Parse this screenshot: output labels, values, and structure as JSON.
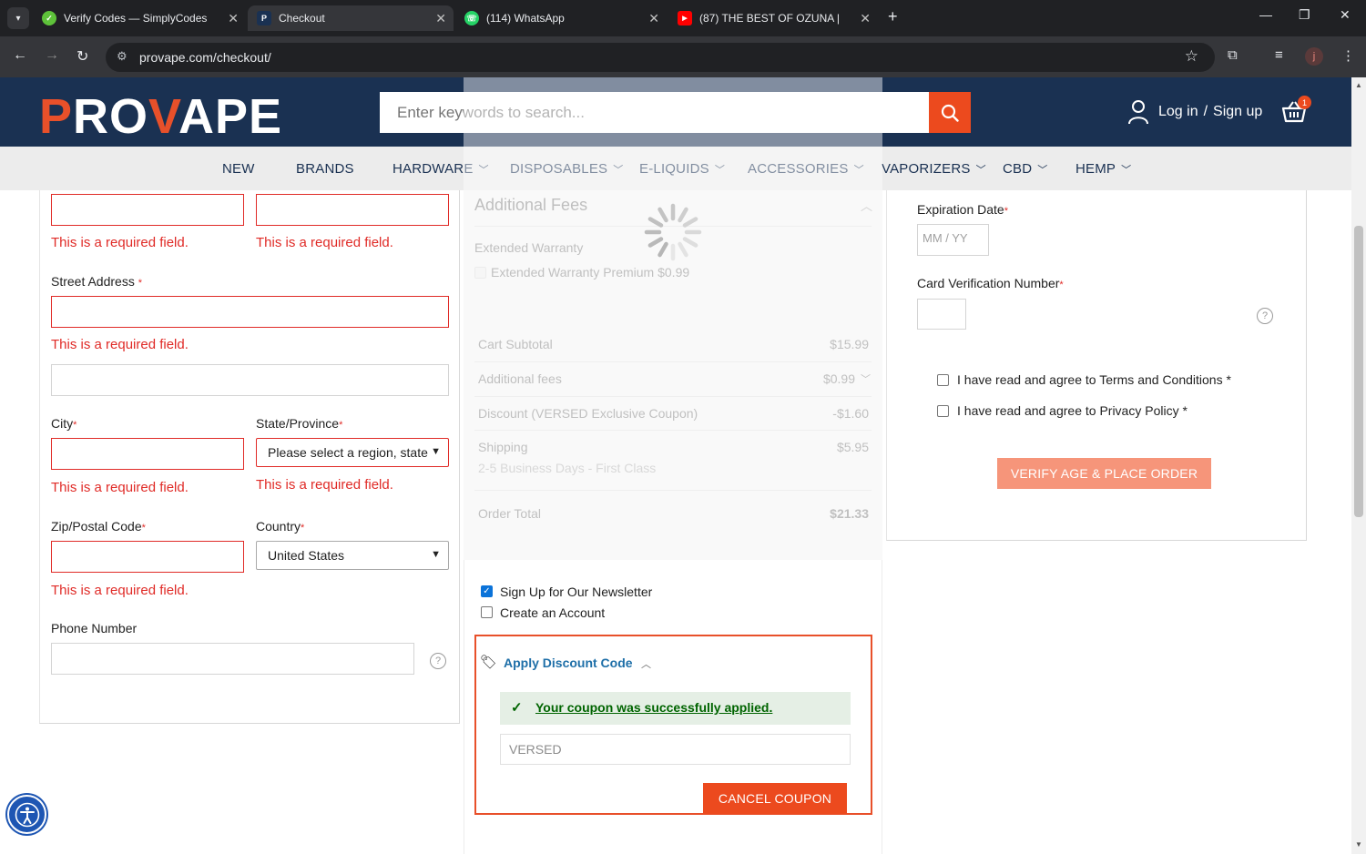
{
  "browser": {
    "tabs": [
      {
        "title": "Verify Codes — SimplyCodes",
        "active": false
      },
      {
        "title": "Checkout",
        "active": true
      },
      {
        "title": "(114) WhatsApp",
        "active": false
      },
      {
        "title": "(87)  THE BEST OF OZUNA |",
        "active": false
      }
    ],
    "url": "provape.com/checkout/",
    "profile_initial": "j"
  },
  "site": {
    "logo_left": "P",
    "logo_mid1": "RO",
    "logo_v": "V",
    "logo_right": "APE",
    "search_placeholder": "Enter keywords to search...",
    "login_label": "Log in",
    "signup_label": "Sign up",
    "login_sep": "/",
    "cart_count": "1",
    "nav": [
      "NEW",
      "BRANDS",
      "HARDWARE",
      "DISPOSABLES",
      "E-LIQUIDS",
      "ACCESSORIES",
      "VAPORIZERS",
      "CBD",
      "HEMP"
    ]
  },
  "billing": {
    "required_msg": "This is a required field.",
    "street_label": "Street Address",
    "city_label": "City",
    "state_label": "State/Province",
    "state_value": "Please select a region, state",
    "zip_label": "Zip/Postal Code",
    "country_label": "Country",
    "country_value": "United States",
    "phone_label": "Phone Number",
    "req_mark": "*"
  },
  "summary": {
    "title": "Additional Fees",
    "warranty_heading": "Extended Warranty",
    "warranty_option": "Extended Warranty Premium $0.99",
    "rows": [
      {
        "label": "Cart Subtotal",
        "value": "$15.99"
      },
      {
        "label": "Additional fees",
        "value": "$0.99"
      },
      {
        "label": "Discount (VERSED Exclusive Coupon)",
        "value": "-$1.60"
      },
      {
        "label": "Shipping",
        "value": "$5.95"
      }
    ],
    "shipping_method": "2-5 Business Days - First Class",
    "total_label": "Order Total",
    "total_value": "$21.33",
    "newsletter_label": "Sign Up for Our Newsletter",
    "newsletter_checked": true,
    "account_label": "Create an Account",
    "account_checked": false,
    "discount_title": "Apply Discount Code",
    "coupon_success": "Your coupon was successfully applied.",
    "coupon_value": "VERSED",
    "cancel_label": "CANCEL COUPON"
  },
  "payment": {
    "expiration_label": "Expiration Date",
    "expiration_placeholder": "MM / YY",
    "cvv_label": "Card Verification Number",
    "terms_label": "I have read and agree to Terms and Conditions",
    "privacy_label": "I have read and agree to Privacy Policy",
    "place_order_label": "VERIFY AGE & PLACE ORDER"
  },
  "colors": {
    "header_bg": "#1a3152",
    "accent": "#ec4a1e",
    "error": "#e02b27",
    "success": "#006400",
    "link": "#1e6fa8"
  }
}
